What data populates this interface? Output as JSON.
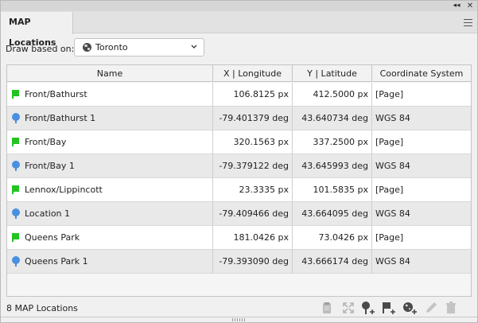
{
  "panel": {
    "tab_title": "MAP Locations",
    "title_controls": {
      "collapse": "◂◂",
      "close": "✕"
    }
  },
  "draw": {
    "label": "Draw based on:",
    "selected": "Toronto",
    "icon": "globe-icon"
  },
  "table": {
    "columns": [
      "Name",
      "X | Longitude",
      "Y | Latitude",
      "Coordinate System"
    ],
    "rows": [
      {
        "name": "Front/Bathurst",
        "icon": "flag",
        "x": "106.8125 px",
        "y": "412.5000 px",
        "cs": "[Page]"
      },
      {
        "name": "Front/Bathurst 1",
        "icon": "pin",
        "x": "-79.401379 deg",
        "y": "43.640734 deg",
        "cs": "WGS 84"
      },
      {
        "name": "Front/Bay",
        "icon": "flag",
        "x": "320.1563 px",
        "y": "337.2500 px",
        "cs": "[Page]"
      },
      {
        "name": "Front/Bay 1",
        "icon": "pin",
        "x": "-79.379122 deg",
        "y": "43.645993 deg",
        "cs": "WGS 84"
      },
      {
        "name": "Lennox/Lippincott",
        "icon": "flag",
        "x": "23.3335 px",
        "y": "101.5835 px",
        "cs": "[Page]"
      },
      {
        "name": "Location 1",
        "icon": "pin",
        "x": "-79.409466 deg",
        "y": "43.664095 deg",
        "cs": "WGS 84"
      },
      {
        "name": "Queens Park",
        "icon": "flag",
        "x": "181.0426 px",
        "y": "73.0426 px",
        "cs": "[Page]"
      },
      {
        "name": "Queens Park 1",
        "icon": "pin",
        "x": "-79.393090 deg",
        "y": "43.666174 deg",
        "cs": "WGS 84"
      }
    ]
  },
  "status": {
    "count_text": "8 MAP Locations"
  },
  "toolbar": {
    "buttons": [
      "clipboard-icon",
      "expand-icon",
      "add-pin-icon",
      "add-flag-icon",
      "add-globe-icon",
      "pencil-icon",
      "trash-icon"
    ]
  },
  "colors": {
    "flag": "#22c422",
    "pin": "#4a8fe0",
    "row_alt": "#e9e9e9"
  }
}
